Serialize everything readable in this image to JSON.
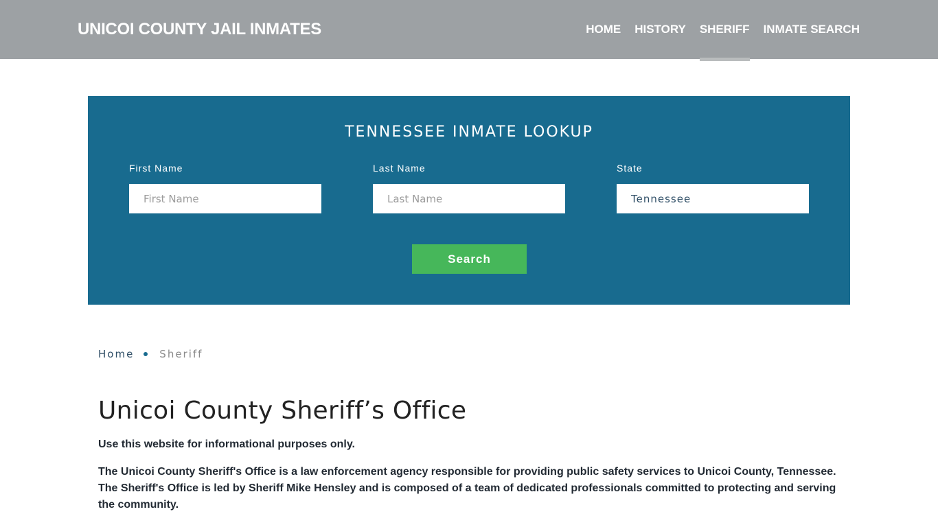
{
  "header": {
    "brand": "UNICOI COUNTY JAIL INMATES",
    "nav": [
      {
        "label": "HOME",
        "active": false
      },
      {
        "label": "HISTORY",
        "active": false
      },
      {
        "label": "SHERIFF",
        "active": true
      },
      {
        "label": "INMATE SEARCH",
        "active": false
      }
    ]
  },
  "lookup": {
    "title": "TENNESSEE INMATE LOOKUP",
    "first_name": {
      "label": "First Name",
      "placeholder": "First Name",
      "value": ""
    },
    "last_name": {
      "label": "Last Name",
      "placeholder": "Last Name",
      "value": ""
    },
    "state": {
      "label": "State",
      "value": "Tennessee"
    },
    "search_label": "Search",
    "colors": {
      "panel": "#186b8f",
      "button": "#46b75a"
    }
  },
  "breadcrumb": {
    "home": "Home",
    "current": "Sheriff"
  },
  "main": {
    "title": "Unicoi County Sheriff’s Office",
    "paragraphs": [
      "Use this website for informational purposes only.",
      "The Unicoi County Sheriff's Office is a law enforcement agency responsible for providing public safety services to Unicoi County, Tennessee. The Sheriff's Office is led by Sheriff Mike Hensley and is composed of a team of dedicated professionals committed to protecting and serving the community."
    ]
  }
}
